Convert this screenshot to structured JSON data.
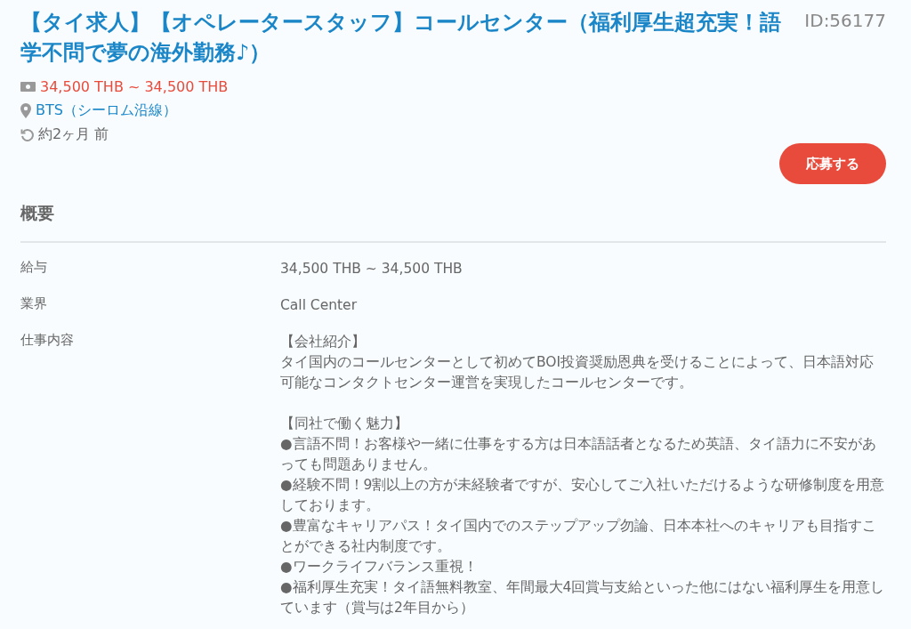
{
  "job": {
    "title": "【タイ求人】【オペレータースタッフ】コールセンター（福利厚生超充実！語学不問で夢の海外勤務♪）",
    "id": "ID:56177",
    "salary": "34,500 THB ~ 34,500 THB",
    "location": "BTS（シーロム沿線）",
    "posted": "約2ヶ月 前"
  },
  "apply_button": "応募する",
  "section_title": "概要",
  "details": [
    {
      "label": "給与",
      "value": "34,500 THB ~ 34,500 THB"
    },
    {
      "label": "業界",
      "value": "Call Center"
    },
    {
      "label": "仕事内容",
      "paragraphs": [
        [
          "【会社紹介】",
          "タイ国内のコールセンターとして初めてBOI投資奨励恩典を受けることによって、日本語対応可能なコンタクトセンター運営を実現したコールセンターです。"
        ],
        [
          "【同社で働く魅力】",
          "●言語不問！お客様や一緒に仕事をする方は日本語話者となるため英語、タイ語力に不安があっても問題ありません。",
          "●経験不問！9割以上の方が未経験者ですが、安心してご入社いただけるような研修制度を用意しております。",
          "●豊富なキャリアパス！タイ国内でのステップアップ勿論、日本本社へのキャリアも目指すことができる社内制度です。",
          "●ワークライフバランス重視！",
          "●福利厚生充実！タイ語無料教室、年間最大4回賞与支給といった他にはない福利厚生を用意しています（賞与は2年目から）"
        ]
      ]
    }
  ]
}
